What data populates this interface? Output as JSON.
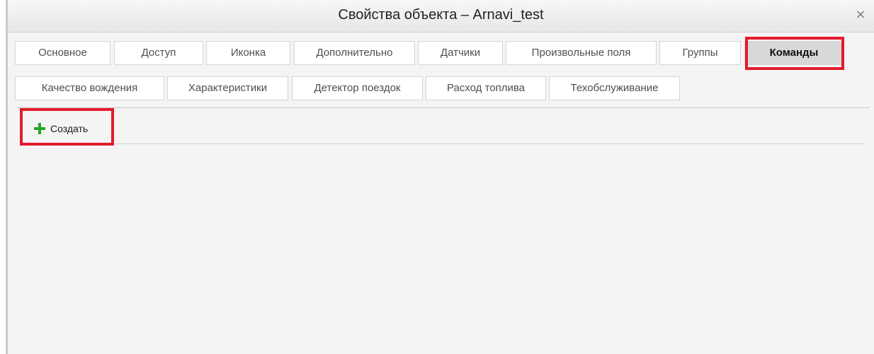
{
  "dialog": {
    "title": "Свойства объекта – Arnavi_test",
    "close_symbol": "×"
  },
  "tabs": [
    {
      "label": "Основное"
    },
    {
      "label": "Доступ"
    },
    {
      "label": "Иконка"
    },
    {
      "label": "Дополнительно"
    },
    {
      "label": "Датчики"
    },
    {
      "label": "Произвольные поля"
    },
    {
      "label": "Группы"
    },
    {
      "label": "Команды",
      "active": true
    },
    {
      "label": "Качество вождения"
    },
    {
      "label": "Характеристики"
    },
    {
      "label": "Детектор поездок"
    },
    {
      "label": "Расход топлива"
    },
    {
      "label": "Техобслуживание"
    }
  ],
  "toolbar": {
    "create_label": "Создать",
    "create_icon": "plus-icon"
  },
  "colors": {
    "highlight": "#e31b2b",
    "plus": "#26a726",
    "active_tab": "#d8d8d8"
  }
}
